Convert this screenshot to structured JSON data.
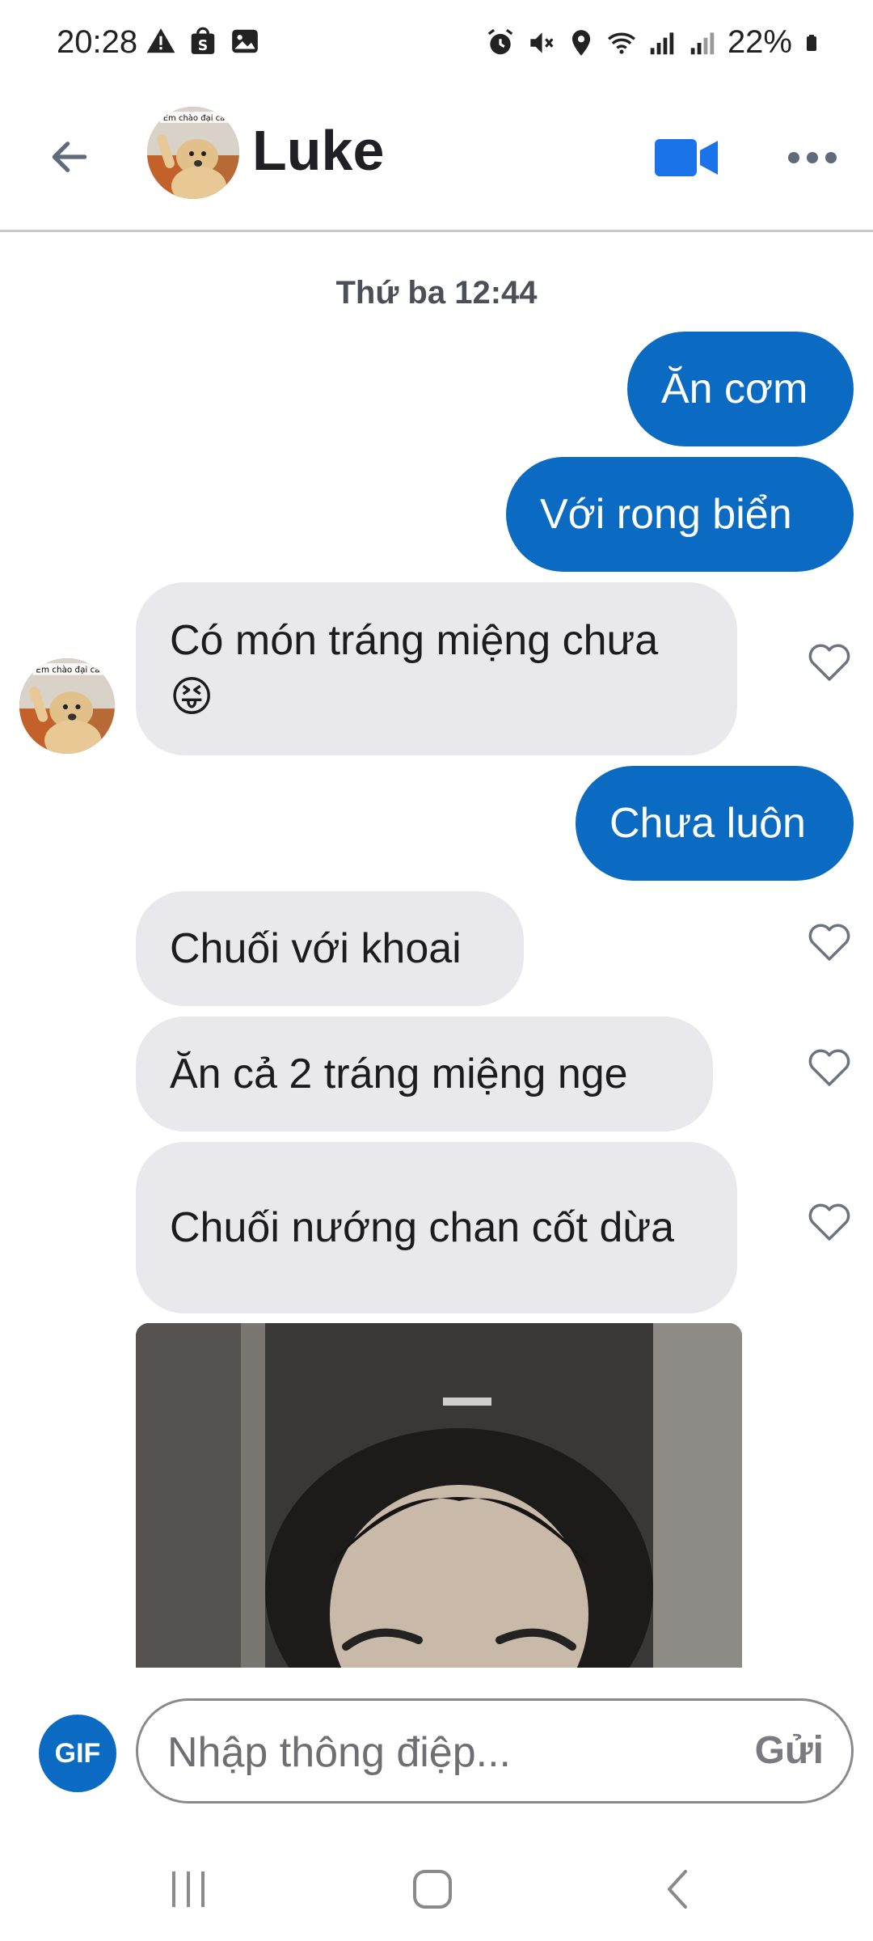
{
  "status_bar": {
    "time": "20:28",
    "battery": "22%",
    "left_icons": [
      "warning-icon",
      "shop-icon",
      "image-icon"
    ],
    "right_icons": [
      "alarm-icon",
      "mute-icon",
      "location-icon",
      "wifi-icon",
      "signal-icon",
      "signal-icon",
      "battery-icon"
    ]
  },
  "header": {
    "contact_name": "Luke",
    "avatar_caption": "Em chào đại ca",
    "icons": [
      "back-arrow-icon",
      "video-call-icon",
      "more-icon"
    ]
  },
  "conversation": {
    "date_separator": "Thứ ba 12:44",
    "messages": [
      {
        "direction": "outgoing",
        "text": "Ăn cơm"
      },
      {
        "direction": "outgoing",
        "text": "Với rong biển"
      },
      {
        "direction": "incoming",
        "text": "Có món tráng miệng chưa 😝"
      },
      {
        "direction": "outgoing",
        "text": "Chưa luôn"
      },
      {
        "direction": "incoming",
        "text": "Chuối với khoai"
      },
      {
        "direction": "incoming",
        "text": "Ăn cả 2 tráng miệng nge"
      },
      {
        "direction": "incoming",
        "text": "Chuối nướng chan cốt dừa"
      },
      {
        "direction": "incoming",
        "type": "gif"
      }
    ]
  },
  "composer": {
    "gif_label": "GIF",
    "placeholder": "Nhập thông điệp...",
    "send_label": "Gửi"
  },
  "colors": {
    "accent": "#0b6bc2",
    "incoming_bubble": "#e9e9ed",
    "header_divider": "#c9c9cc"
  }
}
